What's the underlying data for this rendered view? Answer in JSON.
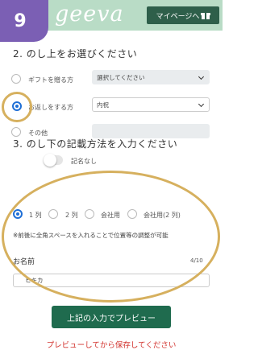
{
  "header": {
    "step_number": "9",
    "logo_text": "geeva",
    "mypage_label": "マイページへ",
    "mypage_icon": "gift-icon"
  },
  "noshi_upper": {
    "title": "2. のし上をお選びください",
    "options": [
      {
        "label": "ギフトを贈る方",
        "selected": false,
        "select_value": "選択してください"
      },
      {
        "label": "お返しをする方",
        "selected": true,
        "select_value": "内祝"
      },
      {
        "label": "その他",
        "selected": false,
        "select_value": ""
      }
    ]
  },
  "noshi_lower": {
    "title": "3. のし下の記載方法を入力ください",
    "toggle_label": "記名なし",
    "toggle_on": false,
    "layout_options": [
      {
        "label": "1 列",
        "selected": true
      },
      {
        "label": "2 列",
        "selected": false
      },
      {
        "label": "会社用",
        "selected": false
      },
      {
        "label": "会社用(2 列)",
        "selected": false
      }
    ],
    "note": "※前後に全角スペースを入れることで位置等の調整が可能",
    "name_label": "お名前",
    "name_counter": "4/10",
    "name_value": "ヒキカ"
  },
  "actions": {
    "preview_button": "上記の入力でプレビュー",
    "warning": "プレビューしてから保存してください"
  },
  "colors": {
    "header_bg": "#b9dcc6",
    "badge_bg": "#7b5fb4",
    "primary_button": "#1f6b4e",
    "warning_text": "#d2322d",
    "radio_selected": "#1f6fd6",
    "annotation": "#d6b05e"
  }
}
